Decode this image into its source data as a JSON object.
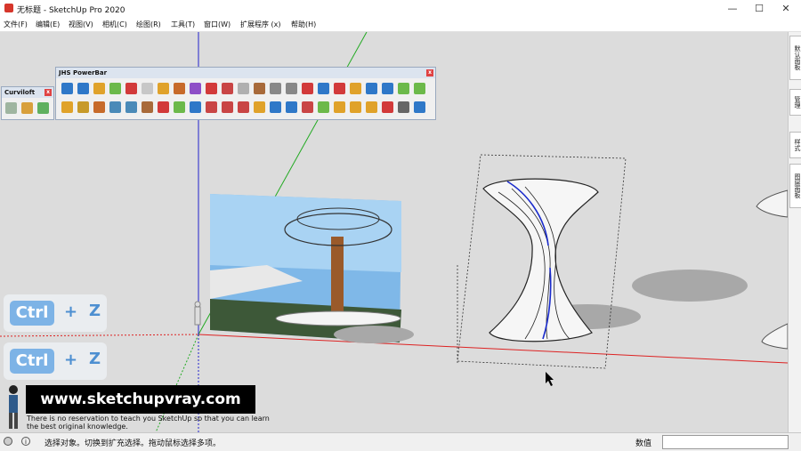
{
  "window": {
    "title": "无标题 - SketchUp Pro 2020",
    "controls": {
      "minimize": "—",
      "maximize": "☐",
      "close": "✕"
    }
  },
  "menu": [
    "文件(F)",
    "编辑(E)",
    "视图(V)",
    "相机(C)",
    "绘图(R)",
    "工具(T)",
    "窗口(W)",
    "扩展程序 (x)",
    "帮助(H)"
  ],
  "tray_tabs": [
    "默认面板",
    "管理",
    "样式",
    "图层面板"
  ],
  "toolbars": {
    "curviloft": {
      "title": "Curviloft",
      "close": "x"
    },
    "powerbar": {
      "title": "JHS PowerBar",
      "close": "x"
    }
  },
  "overlay": {
    "shortcut_keys": [
      {
        "key": "Ctrl",
        "plus": "+",
        "letter": "Z"
      },
      {
        "key": "Ctrl",
        "plus": "+",
        "letter": "Z"
      }
    ],
    "site": "www.sketchupvray.com",
    "subtitle": [
      "There is no reservation to teach you SketchUp so that you can learn",
      "the best original knowledge."
    ]
  },
  "status": {
    "message": "选择对象。切换到扩充选择。拖动鼠标选择多项。",
    "measure_label": "数值",
    "measure_value": "",
    "info_icon": "i"
  },
  "colors": {
    "viewport_bg": "#dcdcdc",
    "axis_red": "#d22",
    "axis_green": "#2a2",
    "axis_blue": "#22c",
    "accent_blue": "#4d8fd1"
  },
  "icons": [
    "app-icon",
    "info-icon",
    "status-light-icon",
    "minimize-icon",
    "maximize-icon",
    "close-icon"
  ]
}
